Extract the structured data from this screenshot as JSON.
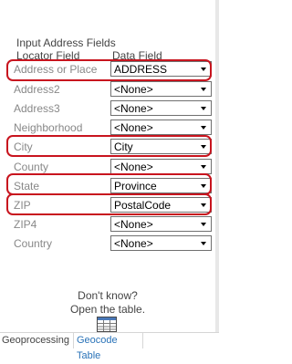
{
  "panel": {
    "title": "Input Address Fields",
    "column_headers": {
      "locator_field": "Locator Field",
      "data_field": "Data Field"
    }
  },
  "rows": [
    {
      "label": "Address or Place",
      "value": "ADDRESS"
    },
    {
      "label": "Address2",
      "value": "<None>"
    },
    {
      "label": "Address3",
      "value": "<None>"
    },
    {
      "label": "Neighborhood",
      "value": "<None>"
    },
    {
      "label": "City",
      "value": "City"
    },
    {
      "label": "County",
      "value": "<None>"
    },
    {
      "label": "State",
      "value": "Province"
    },
    {
      "label": "ZIP",
      "value": "PostalCode"
    },
    {
      "label": "ZIP4",
      "value": "<None>"
    },
    {
      "label": "Country",
      "value": "<None>"
    }
  ],
  "help": {
    "line1": "Don't know?",
    "line2": "Open the table."
  },
  "icons": {
    "open_table": "table-icon"
  },
  "tabs": {
    "geoprocessing": "Geoprocessing",
    "geocode_table": "Geocode Table"
  },
  "colors": {
    "highlight": "#c8141e",
    "active_tab": "#2a73b8"
  }
}
